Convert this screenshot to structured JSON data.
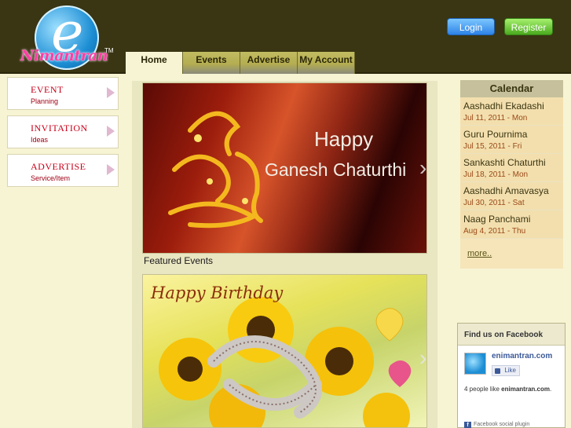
{
  "header": {
    "logo_text": "Nimantran",
    "logo_mark": "e",
    "logo_tm": "TM",
    "login_label": "Login",
    "register_label": "Register"
  },
  "nav": {
    "tabs": [
      {
        "label": "Home",
        "active": true
      },
      {
        "label": "Events",
        "active": false
      },
      {
        "label": "Advertise",
        "active": false
      },
      {
        "label": "My Account",
        "active": false
      }
    ]
  },
  "sidebar": {
    "items": [
      {
        "title": "EVENT",
        "subtitle": "Planning",
        "icon": "chevron-right-icon"
      },
      {
        "title": "INVITATION",
        "subtitle": "Ideas",
        "icon": "chevron-right-icon"
      },
      {
        "title": "ADVERTISE",
        "subtitle": "Service/Item",
        "icon": "chevron-right-icon"
      }
    ]
  },
  "main": {
    "banner1": {
      "line1": "Happy",
      "line2": "Ganesh Chaturthi"
    },
    "featured_label": "Featured Events",
    "banner2": {
      "text": "Happy Birthday"
    }
  },
  "calendar": {
    "title": "Calendar",
    "events": [
      {
        "name": "Aashadhi Ekadashi",
        "date": "Jul 11, 2011 - Mon"
      },
      {
        "name": "Guru Pournima",
        "date": "Jul 15, 2011 - Fri"
      },
      {
        "name": "Sankashti Chaturthi",
        "date": "Jul 18, 2011 - Mon"
      },
      {
        "name": "Aashadhi Amavasya",
        "date": "Jul 30, 2011 - Sat"
      },
      {
        "name": "Naag Panchami",
        "date": "Aug 4, 2011 - Thu"
      }
    ],
    "more_label": "more.."
  },
  "facebook": {
    "heading": "Find us on Facebook",
    "site_name": "enimantran.com",
    "like_label": "Like",
    "count_prefix": "4 people like ",
    "count_site": "enimantran.com",
    "count_suffix": ".",
    "plugin_label": "Facebook social plugin"
  },
  "colors": {
    "header_bg": "#3a3512",
    "page_bg": "#f7f4d4",
    "accent_red": "#c8001a",
    "login_blue": "#2d82e6",
    "register_green": "#4aaa1d"
  }
}
